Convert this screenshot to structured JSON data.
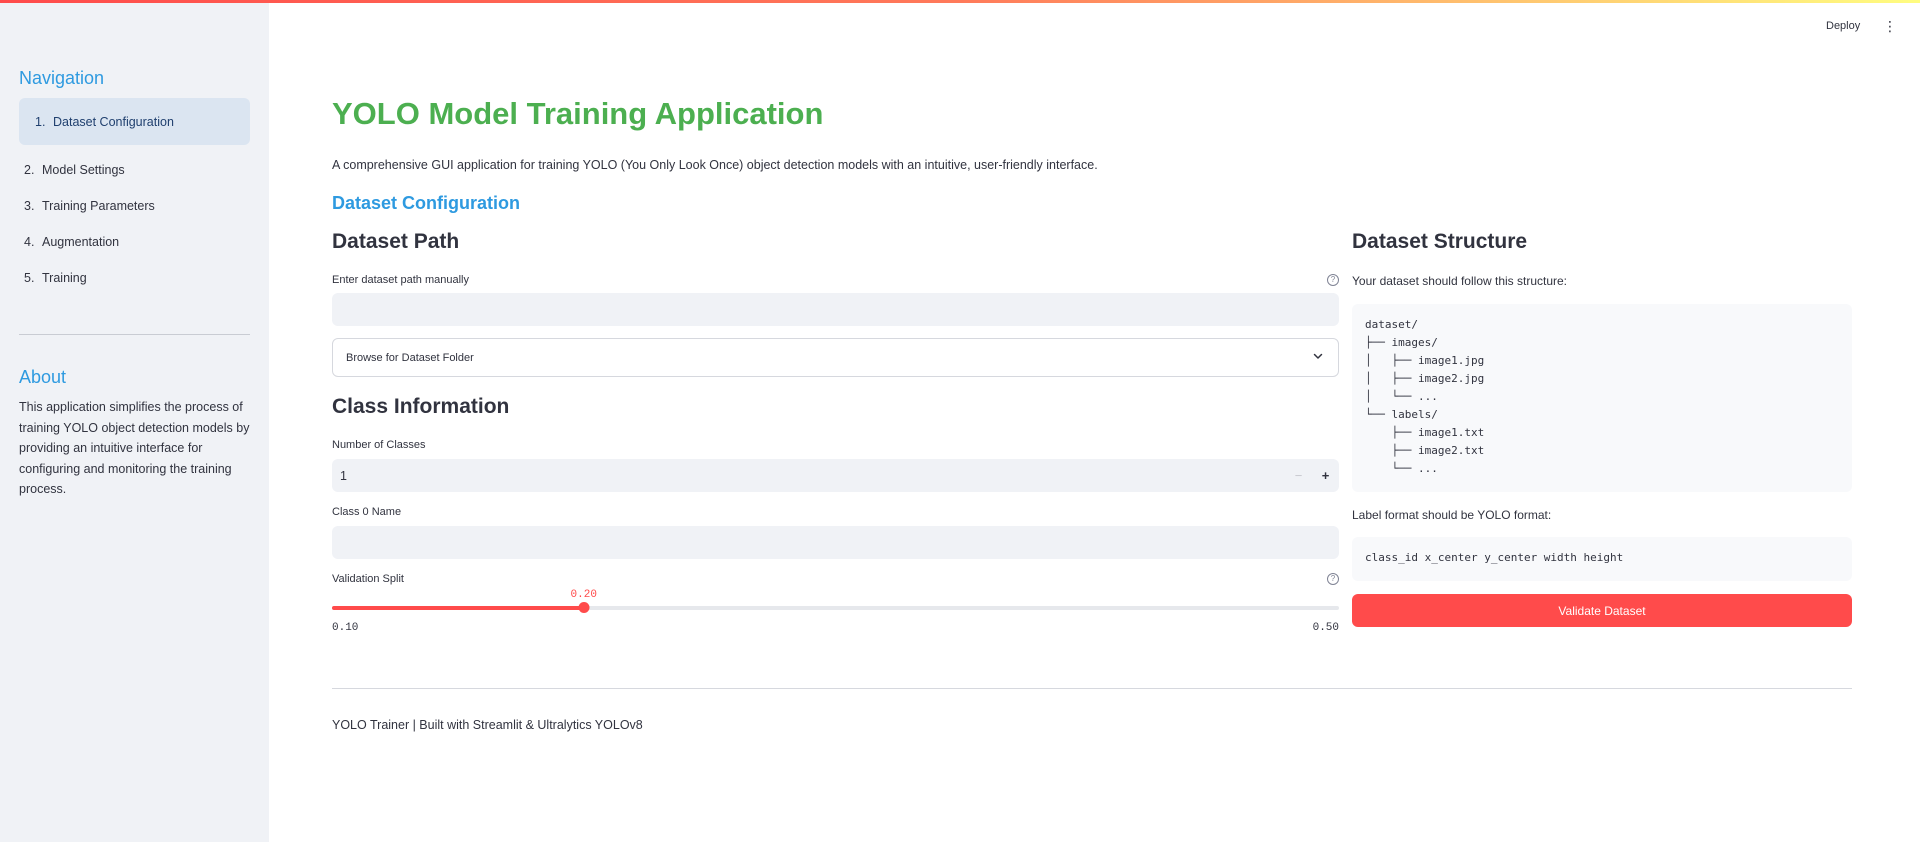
{
  "header": {
    "deploy_label": "Deploy",
    "menu_glyph": "⋮"
  },
  "sidebar": {
    "nav_title": "Navigation",
    "items": [
      {
        "num": "1.",
        "label": "Dataset Configuration",
        "active": true
      },
      {
        "num": "2.",
        "label": "Model Settings",
        "active": false
      },
      {
        "num": "3.",
        "label": "Training Parameters",
        "active": false
      },
      {
        "num": "4.",
        "label": "Augmentation",
        "active": false
      },
      {
        "num": "5.",
        "label": "Training",
        "active": false
      }
    ],
    "about_title": "About",
    "about_text": "This application simplifies the process of training YOLO object detection models by providing an intuitive interface for configuring and monitoring the training process."
  },
  "main": {
    "title": "YOLO Model Training Application",
    "description": "A comprehensive GUI application for training YOLO (You Only Look Once) object detection models with an intuitive, user-friendly interface.",
    "section_title": "Dataset Configuration"
  },
  "dataset_path": {
    "heading": "Dataset Path",
    "input_label": "Enter dataset path manually",
    "input_value": "",
    "browse_label": "Browse for Dataset Folder"
  },
  "class_info": {
    "heading": "Class Information",
    "num_classes_label": "Number of Classes",
    "num_classes_value": "1",
    "minus": "−",
    "plus": "+",
    "class0_label": "Class 0 Name",
    "class0_value": ""
  },
  "validation_split": {
    "label": "Validation Split",
    "value": 0.2,
    "value_text": "0.20",
    "min": 0.1,
    "min_text": "0.10",
    "max": 0.5,
    "max_text": "0.50",
    "accent": "#ff4b4b"
  },
  "dataset_structure": {
    "heading": "Dataset Structure",
    "intro": "Your dataset should follow this structure:",
    "tree": "dataset/\n├── images/\n│   ├── image1.jpg\n│   ├── image2.jpg\n│   └── ...\n└── labels/\n    ├── image1.txt\n    ├── image2.txt\n    └── ...",
    "label_format_text": "Label format should be YOLO format:",
    "label_format_code": "class_id x_center y_center width height",
    "validate_label": "Validate Dataset"
  },
  "footer": {
    "text": "YOLO Trainer | Built with Streamlit & Ultralytics YOLOv8"
  },
  "colors": {
    "title_green": "#4caf50",
    "link_blue": "#2e9ae0",
    "primary_red": "#ff4b4b",
    "sidebar_bg": "#f0f2f6"
  },
  "icons": {
    "help": "question-circle-icon",
    "chevron": "chevron-down-icon",
    "menu": "kebab-menu-icon"
  }
}
